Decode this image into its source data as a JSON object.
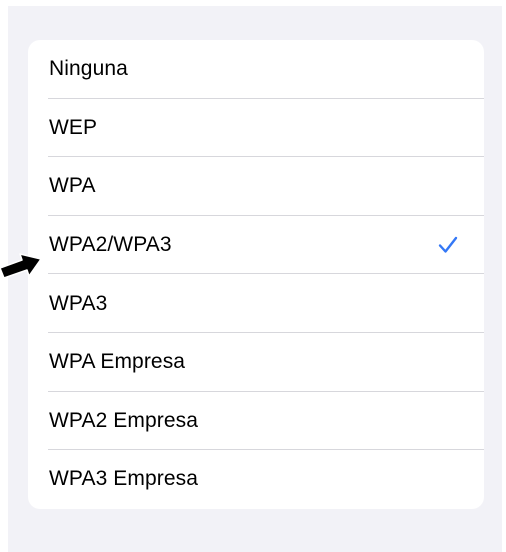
{
  "security_options": {
    "items": [
      {
        "label": "Ninguna",
        "selected": false
      },
      {
        "label": "WEP",
        "selected": false
      },
      {
        "label": "WPA",
        "selected": false
      },
      {
        "label": "WPA2/WPA3",
        "selected": true
      },
      {
        "label": "WPA3",
        "selected": false
      },
      {
        "label": "WPA Empresa",
        "selected": false
      },
      {
        "label": "WPA2 Empresa",
        "selected": false
      },
      {
        "label": "WPA3 Empresa",
        "selected": false
      }
    ],
    "check_icon": "checkmark-icon",
    "accent_color": "#3478f6"
  },
  "annotation": {
    "icon": "arrow-right-icon",
    "color": "#000000"
  }
}
